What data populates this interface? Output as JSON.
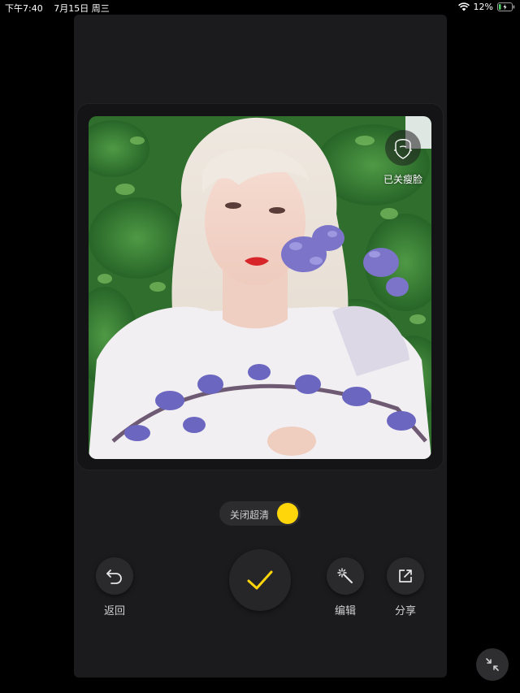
{
  "status_bar": {
    "time": "下午7:40",
    "date": "7月15日 周三",
    "battery_percent": "12%"
  },
  "photo_overlay": {
    "slim_face_label": "已关瘦脸",
    "slim_face_icon": "face-outline-icon"
  },
  "hd_toggle": {
    "label": "关闭超清",
    "state": "on",
    "knob_color": "#ffd60a"
  },
  "actions": {
    "back_label": "返回",
    "back_icon": "undo-icon",
    "confirm_icon": "checkmark-icon",
    "confirm_color": "#ffd60a",
    "edit_label": "编辑",
    "edit_icon": "magic-wand-icon",
    "share_label": "分享",
    "share_icon": "share-icon",
    "collapse_icon": "collapse-arrows-icon"
  }
}
